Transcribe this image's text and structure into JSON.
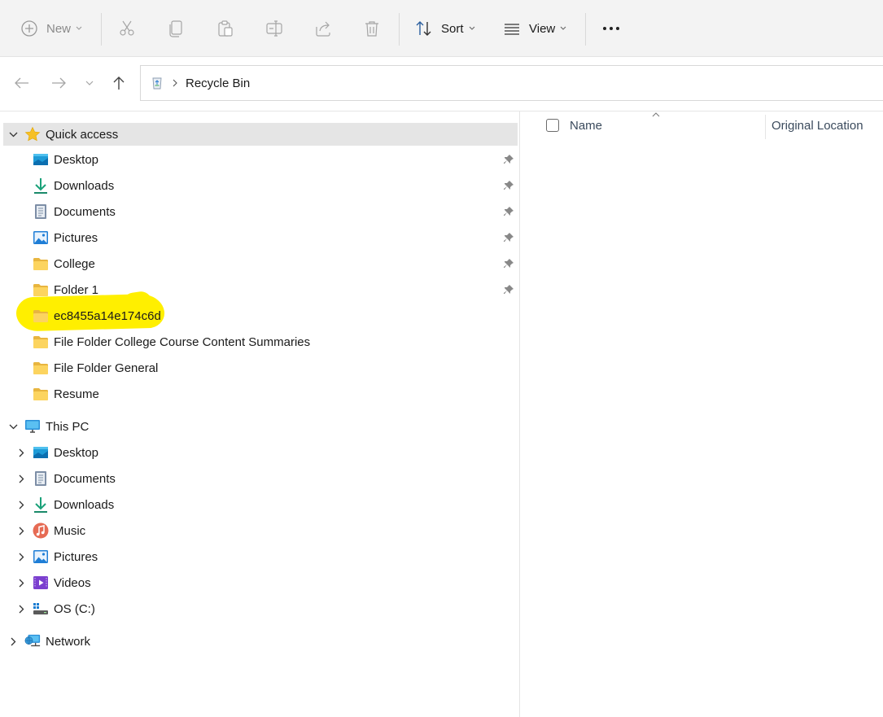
{
  "toolbar": {
    "new_label": "New",
    "sort_label": "Sort",
    "view_label": "View",
    "more_label": "•••",
    "icons": [
      "new-icon",
      "cut-icon",
      "copy-icon",
      "paste-icon",
      "rename-icon",
      "share-icon",
      "delete-icon",
      "sort-icon",
      "view-icon",
      "more-icon"
    ]
  },
  "address": {
    "location": "Recycle Bin",
    "separator": "›"
  },
  "quick_access": {
    "label": "Quick access",
    "items": [
      {
        "label": "Desktop",
        "icon": "desktop-folder-icon",
        "pinned": true
      },
      {
        "label": "Downloads",
        "icon": "downloads-icon",
        "pinned": true
      },
      {
        "label": "Documents",
        "icon": "documents-icon",
        "pinned": true
      },
      {
        "label": "Pictures",
        "icon": "pictures-icon",
        "pinned": true
      },
      {
        "label": "College",
        "icon": "folder-icon",
        "pinned": true
      },
      {
        "label": "Folder 1",
        "icon": "folder-icon",
        "pinned": true
      },
      {
        "label": "ec8455a14e174c6d",
        "icon": "folder-icon",
        "pinned": false
      },
      {
        "label": "File Folder College Course Content Summaries",
        "icon": "folder-icon",
        "pinned": false
      },
      {
        "label": "File Folder General",
        "icon": "folder-icon",
        "pinned": false
      },
      {
        "label": "Resume",
        "icon": "folder-icon",
        "pinned": false
      }
    ]
  },
  "this_pc": {
    "label": "This PC",
    "items": [
      {
        "label": "Desktop",
        "icon": "desktop-folder-icon"
      },
      {
        "label": "Documents",
        "icon": "documents-icon"
      },
      {
        "label": "Downloads",
        "icon": "downloads-icon"
      },
      {
        "label": "Music",
        "icon": "music-icon"
      },
      {
        "label": "Pictures",
        "icon": "pictures-icon"
      },
      {
        "label": "Videos",
        "icon": "videos-icon"
      },
      {
        "label": "OS (C:)",
        "icon": "drive-icon"
      }
    ]
  },
  "network": {
    "label": "Network"
  },
  "columns": {
    "name": "Name",
    "original_location": "Original Location"
  },
  "colors": {
    "toolbar_bg": "#f3f3f3",
    "selected_row_bg": "#e5e5e5",
    "highlight": "#ffef00",
    "folder_yellow": "#f8cd5b",
    "accent_blue": "#0f6cbd"
  }
}
